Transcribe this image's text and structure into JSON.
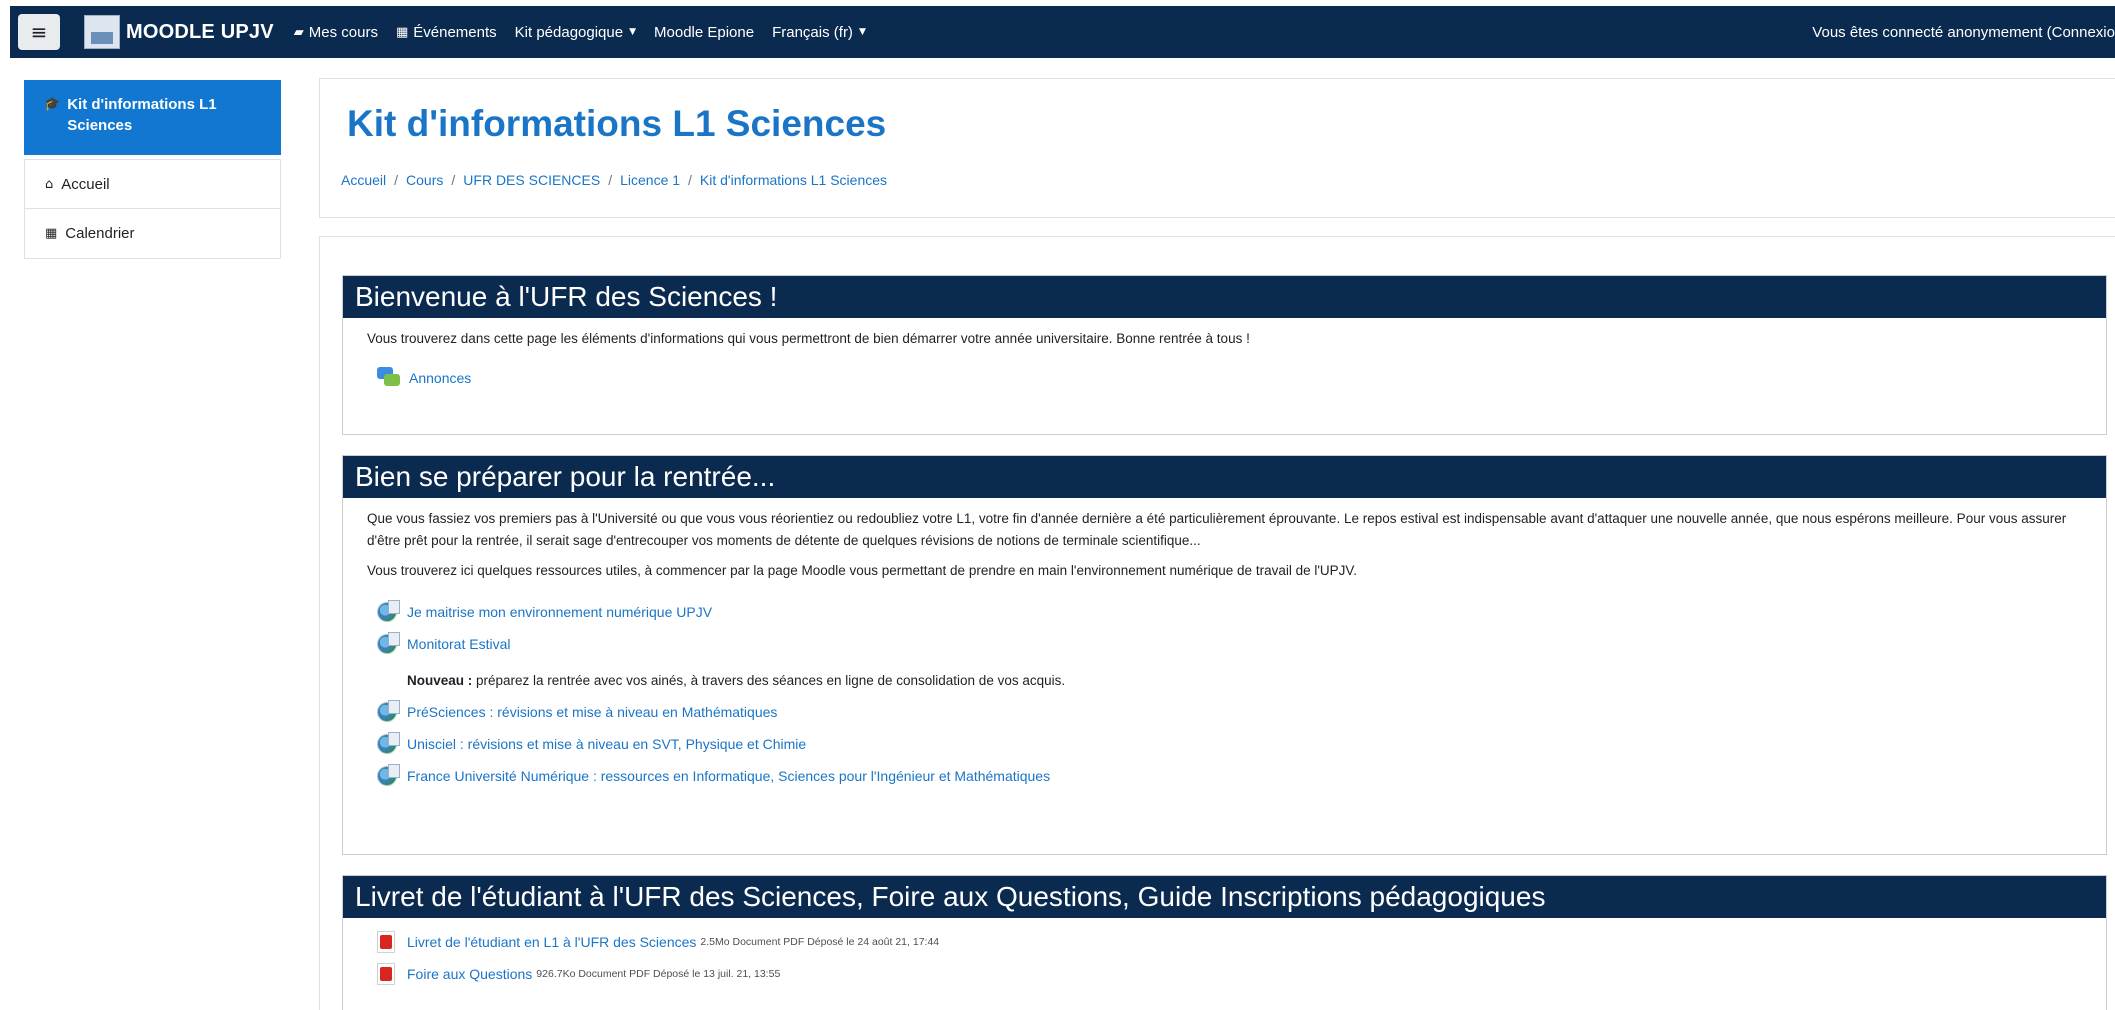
{
  "navbar": {
    "menu_icon": "hamburger-icon",
    "brand": "MOODLE UPJV",
    "items": [
      {
        "icon": "dashboard-icon",
        "glyph": "▰",
        "label": "Mes cours"
      },
      {
        "icon": "calendar-icon",
        "glyph": "▦",
        "label": "Événements"
      },
      {
        "label": "Kit pédagogique",
        "dropdown": true
      },
      {
        "label": "Moodle Epione"
      },
      {
        "label": "Français (fr)",
        "dropdown": true
      }
    ],
    "login_text": "Vous êtes connecté anonymement (Connexio"
  },
  "sidebar": {
    "active": {
      "icon": "graduation-cap-icon",
      "glyph": "🎓",
      "label": "Kit d'informations L1 Sciences"
    },
    "items": [
      {
        "icon": "home-icon",
        "glyph": "⌂",
        "label": "Accueil"
      },
      {
        "icon": "calendar-icon",
        "glyph": "▦",
        "label": "Calendrier"
      }
    ]
  },
  "header": {
    "title": "Kit d'informations L1 Sciences",
    "breadcrumb": [
      "Accueil",
      "Cours",
      "UFR DES SCIENCES",
      "Licence 1",
      "Kit d'informations L1 Sciences"
    ]
  },
  "sections": [
    {
      "title": "Bienvenue à l'UFR des Sciences !",
      "text": "Vous trouverez dans cette page les éléments d'informations qui vous permettront de bien démarrer votre année universitaire. Bonne rentrée à tous !",
      "activities": [
        {
          "label": "Annonces"
        }
      ]
    },
    {
      "title": "Bien se préparer pour la rentrée...",
      "text": "Que vous fassiez vos premiers pas à l'Université ou que vous vous réorientiez ou redoubliez votre L1, votre fin d'année dernière a été particulièrement éprouvante. Le repos estival est indispensable avant d'attaquer une nouvelle année, que nous espérons meilleure. Pour vous assurer d'être prêt pour la rentrée, il serait sage d'entrecouper vos moments de détente de quelques révisions de notions de terminale scientifique...",
      "text2": "Vous trouverez ici quelques ressources utiles, à commencer par la page Moodle vous permettant de prendre en main l'environnement numérique de travail de l'UPJV.",
      "links1": [
        "Je maitrise mon environnement numérique UPJV",
        "Monitorat Estival"
      ],
      "nouveau_bold": "Nouveau :",
      "nouveau_text": " préparez la rentrée avec vos ainés, à travers des séances en ligne de consolidation de vos acquis.",
      "links2": [
        "PréSciences : révisions et mise à niveau en Mathématiques",
        "Unisciel : révisions et mise à niveau en SVT, Physique et Chimie",
        "France Université Numérique : ressources en Informatique, Sciences pour l'Ingénieur et Mathématiques"
      ]
    },
    {
      "title": "Livret de l'étudiant à l'UFR des Sciences, Foire aux Questions, Guide Inscriptions pédagogiques",
      "files": [
        {
          "label": "Livret de l'étudiant en L1 à l'UFR des Sciences",
          "meta": "2.5Mo Document PDF Déposé le 24 août 21, 17:44"
        },
        {
          "label": "Foire aux Questions",
          "meta": "926.7Ko Document PDF Déposé le 13 juil. 21, 13:55"
        }
      ]
    }
  ]
}
